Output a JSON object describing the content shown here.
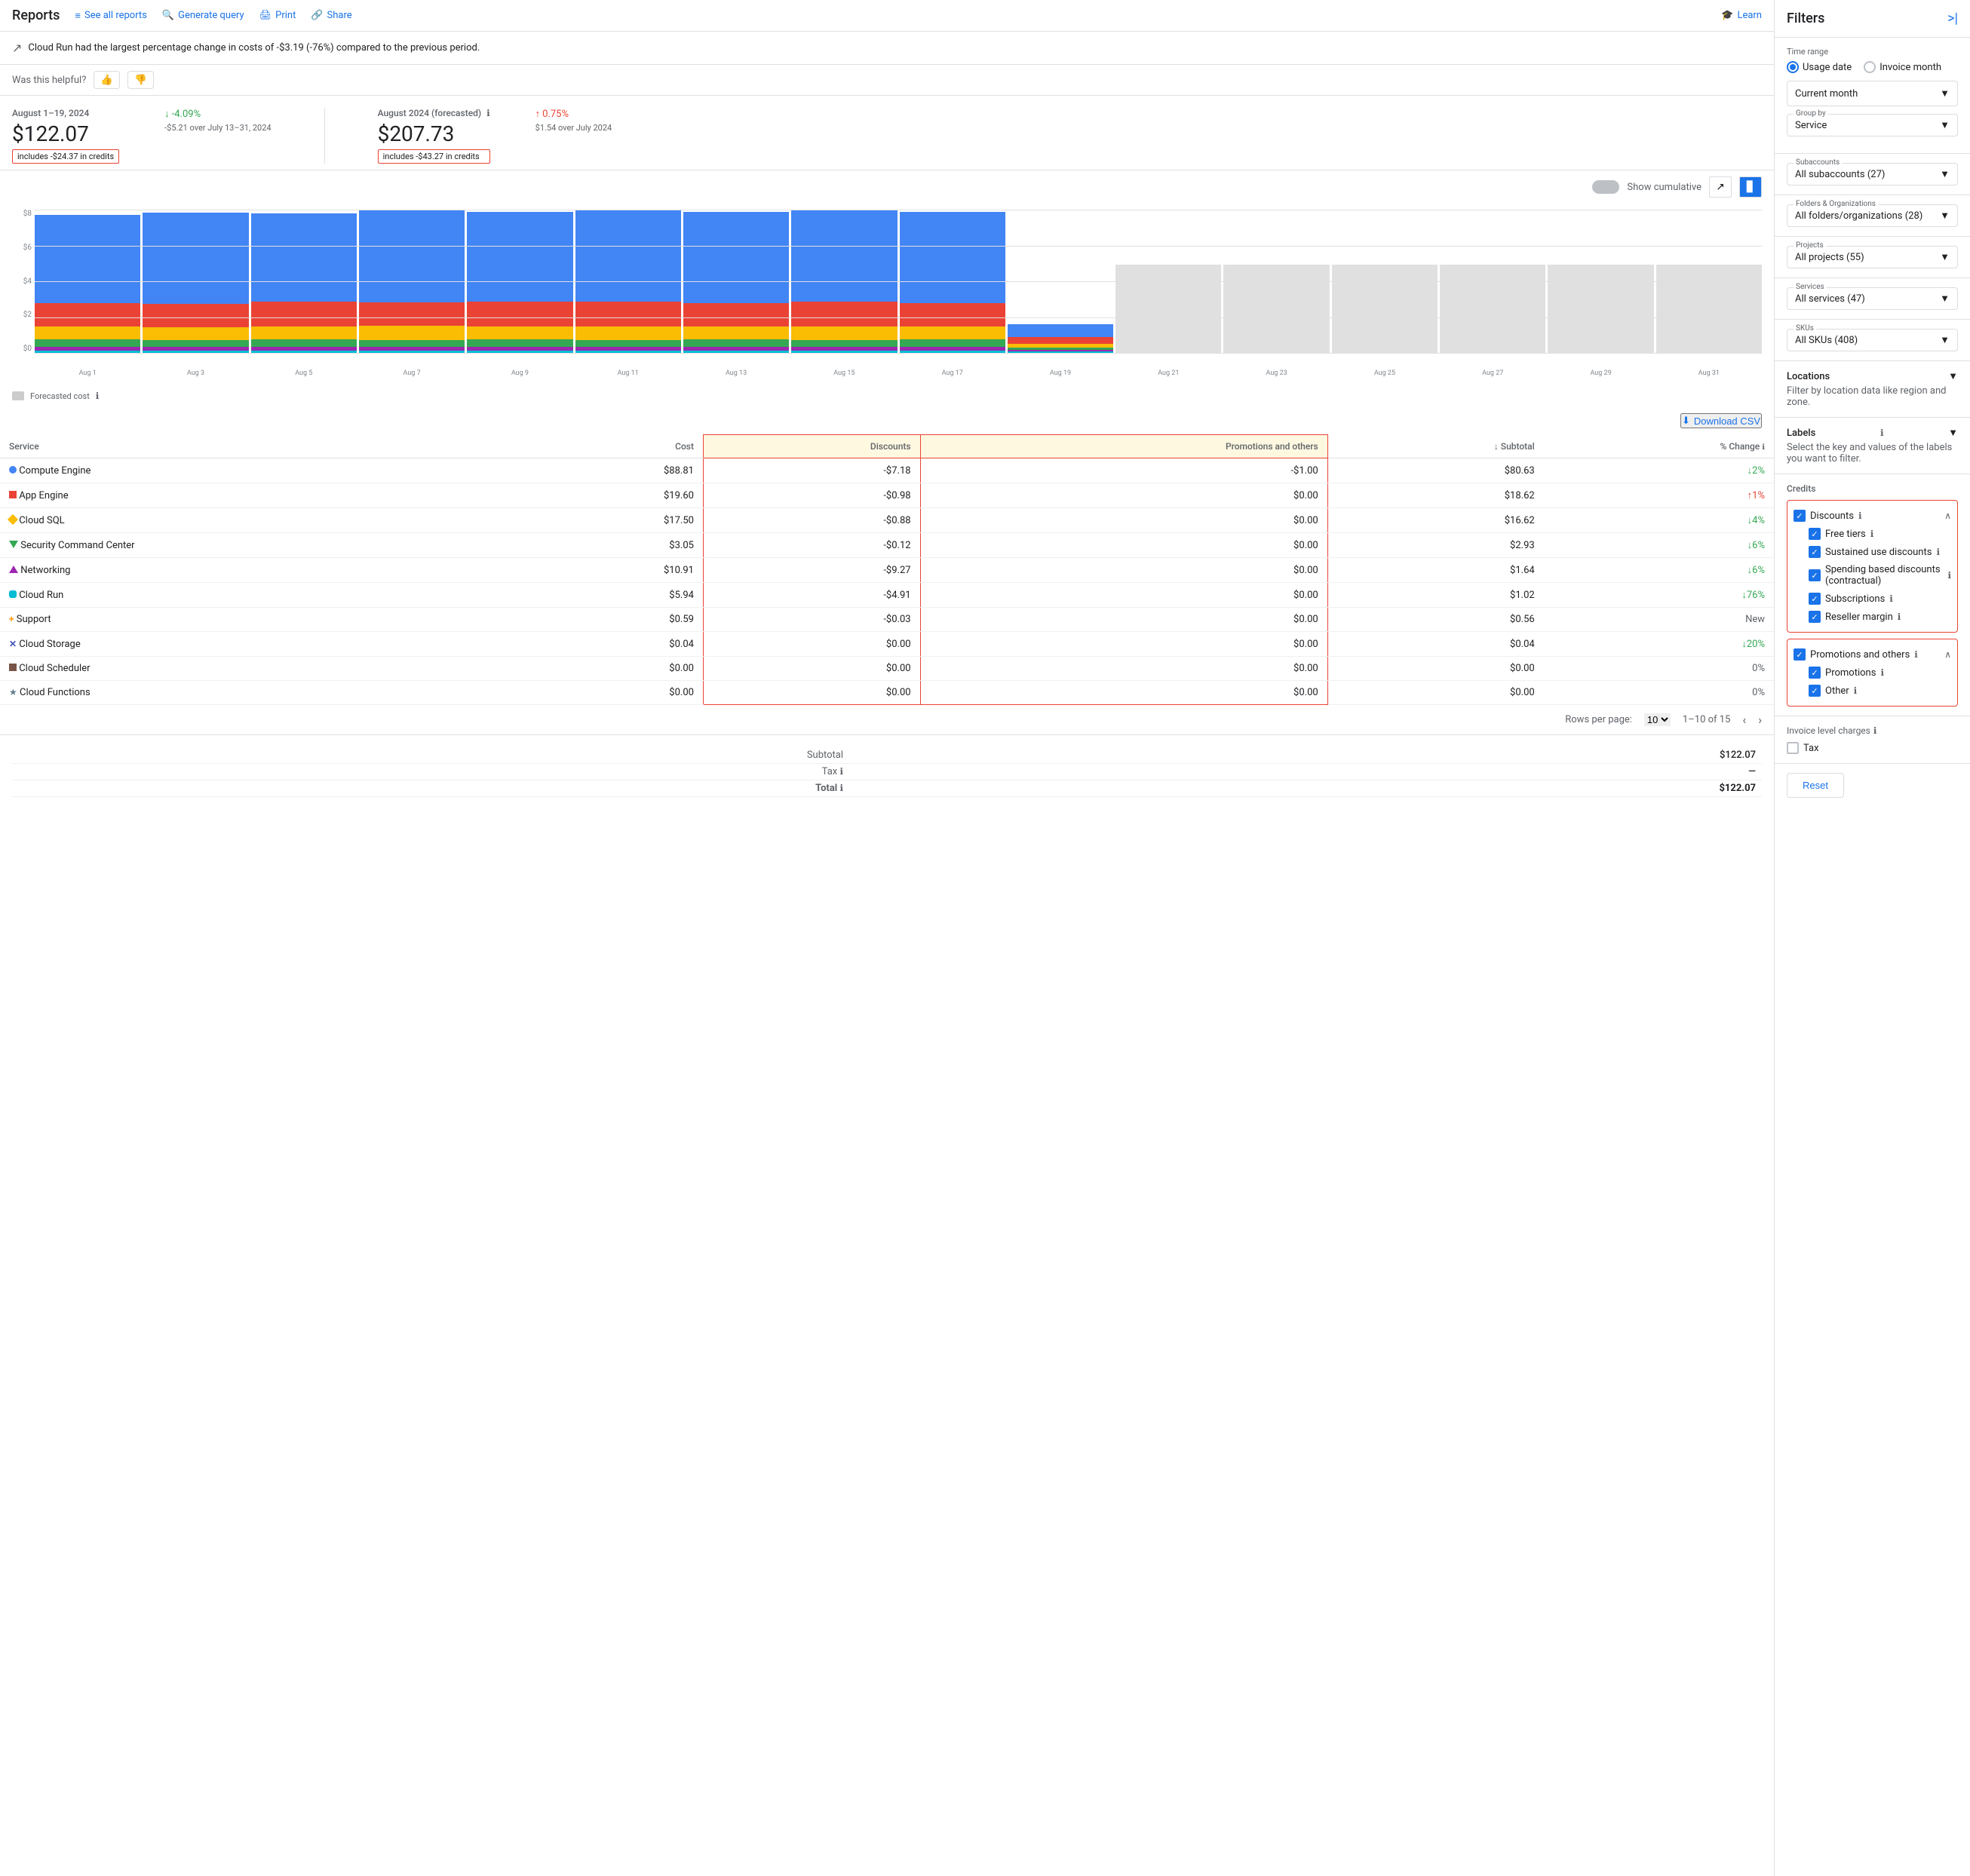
{
  "nav": {
    "title": "Reports",
    "links": [
      {
        "label": "See all reports",
        "icon": "≡"
      },
      {
        "label": "Generate query",
        "icon": "🔍"
      },
      {
        "label": "Print",
        "icon": "🖨"
      },
      {
        "label": "Share",
        "icon": "🔗"
      },
      {
        "label": "Learn",
        "icon": "🎓"
      }
    ]
  },
  "alert": {
    "text": "Cloud Run had the largest percentage change in costs of -$3.19 (-76%) compared to the previous period."
  },
  "feedback": {
    "label": "Was this helpful?"
  },
  "cost_current": {
    "label": "August 1–19, 2024",
    "amount": "$122.07",
    "credits": "includes -$24.37 in credits",
    "change": "-4.09%",
    "change_dir": "down",
    "change_sub": "-$5.21 over July 13–31, 2024"
  },
  "cost_forecast": {
    "label": "August 2024 (forecasted)",
    "amount": "$207.73",
    "credits": "includes -$43.27 in credits",
    "change": "0.75%",
    "change_dir": "up",
    "change_sub": "$1.54 over July 2024"
  },
  "chart": {
    "show_cumulative_label": "Show cumulative",
    "y_labels": [
      "$8",
      "$6",
      "$4",
      "$2",
      "$0"
    ],
    "x_labels": [
      "Aug 1",
      "Aug 3",
      "Aug 5",
      "Aug 7",
      "Aug 9",
      "Aug 11",
      "Aug 13",
      "Aug 15",
      "Aug 17",
      "Aug 19",
      "Aug 21",
      "Aug 23",
      "Aug 25",
      "Aug 27",
      "Aug 29",
      "Aug 31"
    ],
    "forecasted_label": "Forecasted cost",
    "bars": [
      {
        "h_blue": 68,
        "h_orange": 18,
        "h_red": 10,
        "h_yellow": 6,
        "h_green": 3,
        "h_teal": 2,
        "forecasted": false
      },
      {
        "h_blue": 70,
        "h_orange": 18,
        "h_red": 10,
        "h_yellow": 5,
        "h_green": 3,
        "h_teal": 2,
        "forecasted": false
      },
      {
        "h_blue": 68,
        "h_orange": 19,
        "h_red": 10,
        "h_yellow": 6,
        "h_green": 3,
        "h_teal": 2,
        "forecasted": false
      },
      {
        "h_blue": 71,
        "h_orange": 18,
        "h_red": 11,
        "h_yellow": 5,
        "h_green": 3,
        "h_teal": 2,
        "forecasted": false
      },
      {
        "h_blue": 69,
        "h_orange": 19,
        "h_red": 10,
        "h_yellow": 6,
        "h_green": 3,
        "h_teal": 2,
        "forecasted": false
      },
      {
        "h_blue": 72,
        "h_orange": 19,
        "h_red": 11,
        "h_yellow": 5,
        "h_green": 3,
        "h_teal": 2,
        "forecasted": false
      },
      {
        "h_blue": 70,
        "h_orange": 18,
        "h_red": 10,
        "h_yellow": 6,
        "h_green": 3,
        "h_teal": 2,
        "forecasted": false
      },
      {
        "h_blue": 72,
        "h_orange": 19,
        "h_red": 11,
        "h_yellow": 5,
        "h_green": 3,
        "h_teal": 2,
        "forecasted": false
      },
      {
        "h_blue": 70,
        "h_orange": 18,
        "h_red": 10,
        "h_yellow": 6,
        "h_green": 3,
        "h_teal": 2,
        "forecasted": false
      },
      {
        "h_blue": 10,
        "h_orange": 5,
        "h_red": 3,
        "h_yellow": 2,
        "h_green": 1,
        "h_teal": 1,
        "forecasted": false
      },
      {
        "h_blue": 68,
        "h_orange": 0,
        "h_red": 0,
        "h_yellow": 0,
        "h_green": 0,
        "h_teal": 0,
        "forecasted": true
      },
      {
        "h_blue": 68,
        "h_orange": 0,
        "h_red": 0,
        "h_yellow": 0,
        "h_green": 0,
        "h_teal": 0,
        "forecasted": true
      },
      {
        "h_blue": 68,
        "h_orange": 0,
        "h_red": 0,
        "h_yellow": 0,
        "h_green": 0,
        "h_teal": 0,
        "forecasted": true
      },
      {
        "h_blue": 68,
        "h_orange": 0,
        "h_red": 0,
        "h_yellow": 0,
        "h_green": 0,
        "h_teal": 0,
        "forecasted": true
      },
      {
        "h_blue": 68,
        "h_orange": 0,
        "h_red": 0,
        "h_yellow": 0,
        "h_green": 0,
        "h_teal": 0,
        "forecasted": true
      },
      {
        "h_blue": 68,
        "h_orange": 0,
        "h_red": 0,
        "h_yellow": 0,
        "h_green": 0,
        "h_teal": 0,
        "forecasted": true
      }
    ]
  },
  "table": {
    "download_label": "Download CSV",
    "columns": [
      "Service",
      "Cost",
      "Discounts",
      "Promotions and others",
      "↓ Subtotal",
      "% Change"
    ],
    "rows": [
      {
        "service": "Compute Engine",
        "color": "#4285f4",
        "shape": "circle",
        "cost": "$88.81",
        "discounts": "-$7.18",
        "promotions": "-$1.00",
        "subtotal": "$80.63",
        "change": "↓2%",
        "change_dir": "down"
      },
      {
        "service": "App Engine",
        "color": "#ea4335",
        "shape": "square",
        "cost": "$19.60",
        "discounts": "-$0.98",
        "promotions": "$0.00",
        "subtotal": "$18.62",
        "change": "↑1%",
        "change_dir": "up"
      },
      {
        "service": "Cloud SQL",
        "color": "#fbbc04",
        "shape": "diamond",
        "cost": "$17.50",
        "discounts": "-$0.88",
        "promotions": "$0.00",
        "subtotal": "$16.62",
        "change": "↓4%",
        "change_dir": "down"
      },
      {
        "service": "Security Command Center",
        "color": "#34a853",
        "shape": "triangle-down",
        "cost": "$3.05",
        "discounts": "-$0.12",
        "promotions": "$0.00",
        "subtotal": "$2.93",
        "change": "↓6%",
        "change_dir": "down"
      },
      {
        "service": "Networking",
        "color": "#9c27b0",
        "shape": "triangle-up",
        "cost": "$10.91",
        "discounts": "-$9.27",
        "promotions": "$0.00",
        "subtotal": "$1.64",
        "change": "↓6%",
        "change_dir": "down"
      },
      {
        "service": "Cloud Run",
        "color": "#00bcd4",
        "shape": "square-rounded",
        "cost": "$5.94",
        "discounts": "-$4.91",
        "promotions": "$0.00",
        "subtotal": "$1.02",
        "change": "↓76%",
        "change_dir": "down"
      },
      {
        "service": "Support",
        "color": "#ff9800",
        "shape": "plus",
        "cost": "$0.59",
        "discounts": "-$0.03",
        "promotions": "$0.00",
        "subtotal": "$0.56",
        "change": "New",
        "change_dir": "none"
      },
      {
        "service": "Cloud Storage",
        "color": "#3f51b5",
        "shape": "x",
        "cost": "$0.04",
        "discounts": "$0.00",
        "promotions": "$0.00",
        "subtotal": "$0.04",
        "change": "↓20%",
        "change_dir": "down"
      },
      {
        "service": "Cloud Scheduler",
        "color": "#795548",
        "shape": "square",
        "cost": "$0.00",
        "discounts": "$0.00",
        "promotions": "$0.00",
        "subtotal": "$0.00",
        "change": "0%",
        "change_dir": "none"
      },
      {
        "service": "Cloud Functions",
        "color": "#607d8b",
        "shape": "star",
        "cost": "$0.00",
        "discounts": "$0.00",
        "promotions": "$0.00",
        "subtotal": "$0.00",
        "change": "0%",
        "change_dir": "none"
      }
    ],
    "pagination": {
      "rows_per_page": "10",
      "range": "1–10 of 15"
    }
  },
  "totals": {
    "subtotal_label": "Subtotal",
    "subtotal_value": "$122.07",
    "tax_label": "Tax",
    "tax_value": "—",
    "total_label": "Total",
    "total_value": "$122.07"
  },
  "sidebar": {
    "title": "Filters",
    "collapse_icon": ">|",
    "time_range_label": "Time range",
    "usage_date_label": "Usage date",
    "invoice_month_label": "Invoice month",
    "current_month_label": "Current month",
    "group_by_label": "Group by",
    "group_by_value": "Service",
    "subaccounts_label": "Subaccounts",
    "subaccounts_value": "All subaccounts (27)",
    "folders_label": "Folders & Organizations",
    "folders_value": "All folders/organizations (28)",
    "projects_label": "Projects",
    "projects_value": "All projects (55)",
    "services_label": "Services",
    "services_value": "All services (47)",
    "skus_label": "SKUs",
    "skus_value": "All SKUs (408)",
    "locations_label": "Locations",
    "locations_description": "Filter by location data like region and zone.",
    "labels_label": "Labels",
    "labels_description": "Select the key and values of the labels you want to filter.",
    "credits_label": "Credits",
    "credits": {
      "discounts": {
        "label": "Discounts",
        "checked": true
      },
      "free_tiers": {
        "label": "Free tiers",
        "checked": true
      },
      "sustained_use": {
        "label": "Sustained use discounts",
        "checked": true
      },
      "spending_based": {
        "label": "Spending based discounts (contractual)",
        "checked": true
      },
      "subscriptions": {
        "label": "Subscriptions",
        "checked": true
      },
      "reseller_margin": {
        "label": "Reseller margin",
        "checked": true
      },
      "promotions": {
        "label": "Promotions and others",
        "checked": true
      },
      "promotions_sub": {
        "label": "Promotions",
        "checked": true
      },
      "other": {
        "label": "Other",
        "checked": true
      }
    },
    "invoice_charges_label": "Invoice level charges",
    "tax_label": "Tax",
    "reset_label": "Reset"
  }
}
